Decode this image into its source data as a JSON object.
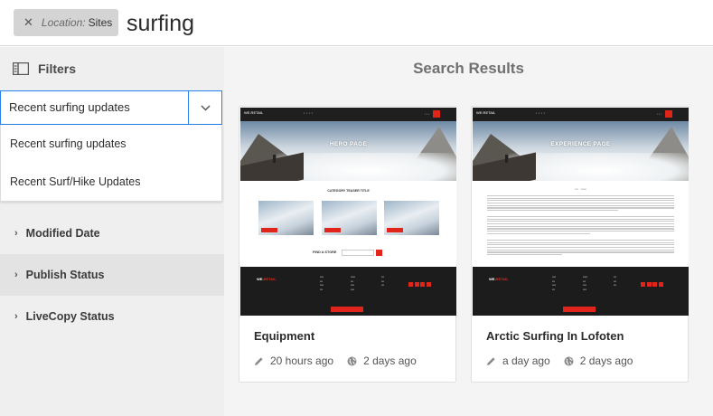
{
  "search": {
    "tag_key": "Location:",
    "tag_value": "Sites",
    "query": "surfing"
  },
  "filters": {
    "title": "Filters",
    "select_value": "Recent surfing updates",
    "dropdown_options": [
      "Recent surfing updates",
      "Recent Surf/Hike Updates"
    ],
    "facets": [
      "Modified Date",
      "Publish Status",
      "LiveCopy Status"
    ]
  },
  "results": {
    "title": "Search Results",
    "cards": [
      {
        "title": "Equipment",
        "modified": "20 hours ago",
        "published": "2 days ago",
        "thumb": {
          "brand": "WE.RETAIL",
          "hero": "HERO PAGE",
          "section": "CATEGORY TEASER TITLE",
          "find": "FIND A STORE",
          "footer_brand_a": "WE.",
          "footer_brand_b": "RETAIL"
        }
      },
      {
        "title": "Arctic Surfing In Lofoten",
        "modified": "a day ago",
        "published": "2 days ago",
        "thumb": {
          "brand": "WE.RETAIL",
          "hero": "EXPERIENCE PAGE",
          "footer_brand_a": "WE.",
          "footer_brand_b": "RETAIL"
        }
      }
    ]
  },
  "colors": {
    "accent_blue": "#2680eb",
    "brand_red": "#e1251b",
    "rail_bg": "#efefef"
  }
}
